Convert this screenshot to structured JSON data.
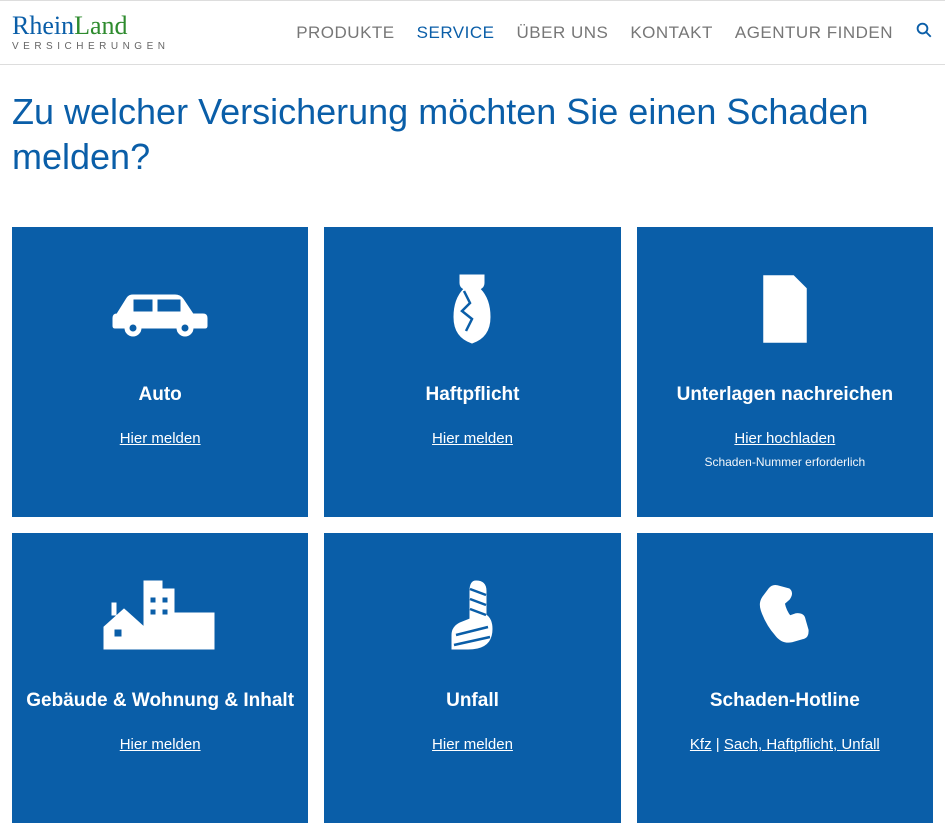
{
  "logo": {
    "part1": "Rhein",
    "part2": "Land",
    "subtitle": "VERSICHERUNGEN",
    "color1": "#0a5ea8",
    "color2": "#2e8b2e"
  },
  "nav": {
    "produkte": "PRODUKTE",
    "service": "SERVICE",
    "ueber_uns": "ÜBER UNS",
    "kontakt": "KONTAKT",
    "agentur_finden": "AGENTUR FINDEN"
  },
  "heading": "Zu welcher Versicherung möchten Sie einen Schaden melden?",
  "tiles": {
    "auto": {
      "title": "Auto",
      "link": "Hier melden"
    },
    "haftpflicht": {
      "title": "Haftpflicht",
      "link": "Hier melden"
    },
    "unterlagen": {
      "title": "Unterlagen nachreichen",
      "link": "Hier hochladen",
      "note": "Schaden-Nummer erforderlich"
    },
    "gebaeude": {
      "title": "Gebäude & Wohnung & Inhalt",
      "link": "Hier melden"
    },
    "unfall": {
      "title": "Unfall",
      "link": "Hier melden"
    },
    "hotline": {
      "title": "Schaden-Hotline",
      "link1": "Kfz",
      "sep": " | ",
      "link2": "Sach, Haftpflicht, Unfall"
    }
  }
}
